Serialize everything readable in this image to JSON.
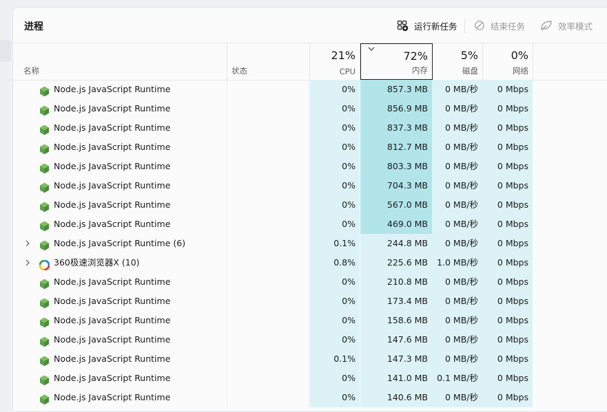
{
  "panel": {
    "title": "进程"
  },
  "toolbar": {
    "run_new_task": "运行新任务",
    "end_task": "结束任务",
    "efficiency_mode": "效率模式"
  },
  "columns": {
    "name": "名称",
    "status": "状态",
    "cpu": {
      "percent": "21%",
      "label": "CPU"
    },
    "memory": {
      "percent": "72%",
      "label": "内存"
    },
    "disk": {
      "percent": "5%",
      "label": "磁盘"
    },
    "network": {
      "percent": "0%",
      "label": "网络"
    }
  },
  "processes": [
    {
      "name": "Node.js JavaScript Runtime",
      "icon": "nodejs-icon",
      "expandable": false,
      "cpu": "0%",
      "memory": "857.3 MB",
      "disk": "0 MB/秒",
      "network": "0 Mbps"
    },
    {
      "name": "Node.js JavaScript Runtime",
      "icon": "nodejs-icon",
      "expandable": false,
      "cpu": "0%",
      "memory": "856.9 MB",
      "disk": "0 MB/秒",
      "network": "0 Mbps"
    },
    {
      "name": "Node.js JavaScript Runtime",
      "icon": "nodejs-icon",
      "expandable": false,
      "cpu": "0%",
      "memory": "837.3 MB",
      "disk": "0 MB/秒",
      "network": "0 Mbps"
    },
    {
      "name": "Node.js JavaScript Runtime",
      "icon": "nodejs-icon",
      "expandable": false,
      "cpu": "0%",
      "memory": "812.7 MB",
      "disk": "0 MB/秒",
      "network": "0 Mbps"
    },
    {
      "name": "Node.js JavaScript Runtime",
      "icon": "nodejs-icon",
      "expandable": false,
      "cpu": "0%",
      "memory": "803.3 MB",
      "disk": "0 MB/秒",
      "network": "0 Mbps"
    },
    {
      "name": "Node.js JavaScript Runtime",
      "icon": "nodejs-icon",
      "expandable": false,
      "cpu": "0%",
      "memory": "704.3 MB",
      "disk": "0 MB/秒",
      "network": "0 Mbps"
    },
    {
      "name": "Node.js JavaScript Runtime",
      "icon": "nodejs-icon",
      "expandable": false,
      "cpu": "0%",
      "memory": "567.0 MB",
      "disk": "0 MB/秒",
      "network": "0 Mbps"
    },
    {
      "name": "Node.js JavaScript Runtime",
      "icon": "nodejs-icon",
      "expandable": false,
      "cpu": "0%",
      "memory": "469.0 MB",
      "disk": "0 MB/秒",
      "network": "0 Mbps"
    },
    {
      "name": "Node.js JavaScript Runtime (6)",
      "icon": "nodejs-icon",
      "expandable": true,
      "cpu": "0.1%",
      "memory": "244.8 MB",
      "disk": "0 MB/秒",
      "network": "0 Mbps"
    },
    {
      "name": "360极速浏览器X (10)",
      "icon": "browser-360-icon",
      "expandable": true,
      "cpu": "0.8%",
      "memory": "225.6 MB",
      "disk": "1.0 MB/秒",
      "network": "0 Mbps"
    },
    {
      "name": "Node.js JavaScript Runtime",
      "icon": "nodejs-icon",
      "expandable": false,
      "cpu": "0%",
      "memory": "210.8 MB",
      "disk": "0 MB/秒",
      "network": "0 Mbps"
    },
    {
      "name": "Node.js JavaScript Runtime",
      "icon": "nodejs-icon",
      "expandable": false,
      "cpu": "0%",
      "memory": "173.4 MB",
      "disk": "0 MB/秒",
      "network": "0 Mbps"
    },
    {
      "name": "Node.js JavaScript Runtime",
      "icon": "nodejs-icon",
      "expandable": false,
      "cpu": "0%",
      "memory": "158.6 MB",
      "disk": "0 MB/秒",
      "network": "0 Mbps"
    },
    {
      "name": "Node.js JavaScript Runtime",
      "icon": "nodejs-icon",
      "expandable": false,
      "cpu": "0%",
      "memory": "147.6 MB",
      "disk": "0 MB/秒",
      "network": "0 Mbps"
    },
    {
      "name": "Node.js JavaScript Runtime",
      "icon": "nodejs-icon",
      "expandable": false,
      "cpu": "0.1%",
      "memory": "147.3 MB",
      "disk": "0 MB/秒",
      "network": "0 Mbps"
    },
    {
      "name": "Node.js JavaScript Runtime",
      "icon": "nodejs-icon",
      "expandable": false,
      "cpu": "0%",
      "memory": "141.0 MB",
      "disk": "0.1 MB/秒",
      "network": "0 Mbps"
    },
    {
      "name": "Node.js JavaScript Runtime",
      "icon": "nodejs-icon",
      "expandable": false,
      "cpu": "0%",
      "memory": "140.6 MB",
      "disk": "0 MB/秒",
      "network": "0 Mbps"
    }
  ],
  "colors": {
    "heat_light": "#dcf2f6",
    "heat_dark": "#b2e5ea",
    "nodejs_green": "#5fa04e"
  }
}
